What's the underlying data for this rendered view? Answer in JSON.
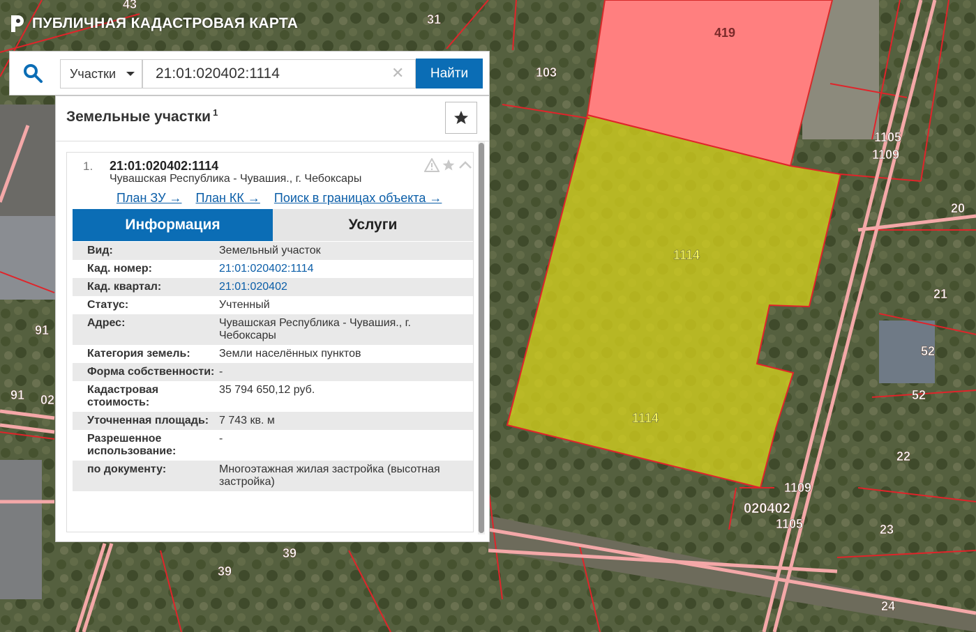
{
  "app": {
    "title": "ПУБЛИЧНАЯ КАДАСТРОВАЯ КАРТА"
  },
  "search": {
    "type_label": "Участки",
    "value": "21:01:020402:1114",
    "find_label": "Найти"
  },
  "results": {
    "title": "Земельные участки",
    "count": "1",
    "item": {
      "index": "1.",
      "cad_number": "21:01:020402:1114",
      "address": "Чувашская Республика - Чувашия., г. Чебоксары",
      "links": [
        "План ЗУ →",
        "План КК →",
        "Поиск в границах объекта →"
      ],
      "tabs": [
        "Информация",
        "Услуги"
      ],
      "info": [
        {
          "label": "Вид:",
          "value": "Земельный участок"
        },
        {
          "label": "Кад. номер:",
          "value": "21:01:020402:1114"
        },
        {
          "label": "Кад. квартал:",
          "value": "21:01:020402"
        },
        {
          "label": "Статус:",
          "value": "Учтенный"
        },
        {
          "label": "Адрес:",
          "value": "Чувашская Республика - Чувашия., г. Чебоксары"
        },
        {
          "label": "Категория земель:",
          "value": "Земли населённых пунктов"
        },
        {
          "label": "Форма собственности:",
          "value": "-"
        },
        {
          "label": "Кадастровая стоимость:",
          "value": "35 794 650,12 руб."
        },
        {
          "label": "Уточненная площадь:",
          "value": "7 743 кв. м"
        },
        {
          "label": "Разрешенное использование:",
          "value": "-"
        },
        {
          "label": "по документу:",
          "value": "Многоэтажная жилая застройка (высотная застройка)"
        }
      ]
    }
  },
  "map": {
    "labels": [
      "43",
      "31",
      "419",
      "103",
      "1105",
      "1109",
      "20",
      "1114",
      "1114",
      "21",
      "52",
      "52",
      "91",
      "91",
      "02",
      "22",
      "1109",
      "020402",
      "1105",
      "23",
      "39",
      "39",
      "24"
    ]
  },
  "colors": {
    "accent": "#0b6db5",
    "selected_parcel": "#d4cf1c",
    "highlight_parcel": "#ff7b7b",
    "boundary": "#e0242a"
  }
}
